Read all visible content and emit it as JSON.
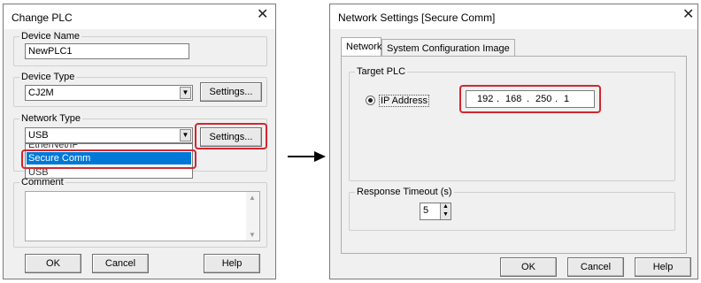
{
  "change_plc": {
    "title": "Change PLC",
    "device_name": {
      "label": "Device Name",
      "value": "NewPLC1"
    },
    "device_type": {
      "label": "Device Type",
      "value": "CJ2M",
      "settings_button": "Settings..."
    },
    "network_type": {
      "label": "Network Type",
      "value": "USB",
      "settings_button": "Settings...",
      "options": [
        "EtherNet/IP",
        "Secure Comm",
        "USB"
      ],
      "highlighted_option": "Secure Comm"
    },
    "comment": {
      "label": "Comment"
    },
    "buttons": {
      "ok": "OK",
      "cancel": "Cancel",
      "help": "Help"
    }
  },
  "arrow": "arrow-right-icon",
  "network_settings": {
    "title": "Network Settings [Secure Comm]",
    "tabs": [
      "Network",
      "System Configuration Image"
    ],
    "active_tab": "Network",
    "target_plc": {
      "label": "Target PLC",
      "radio_label": "IP Address",
      "ip": [
        "192",
        "168",
        "250",
        "1"
      ]
    },
    "response_timeout": {
      "label": "Response Timeout (s)",
      "value": "5"
    },
    "buttons": {
      "ok": "OK",
      "cancel": "Cancel",
      "help": "Help"
    }
  },
  "colors": {
    "highlight_red": "#d1272f",
    "selection_blue": "#0078d7",
    "dialog_bg": "#f0f0f0"
  }
}
